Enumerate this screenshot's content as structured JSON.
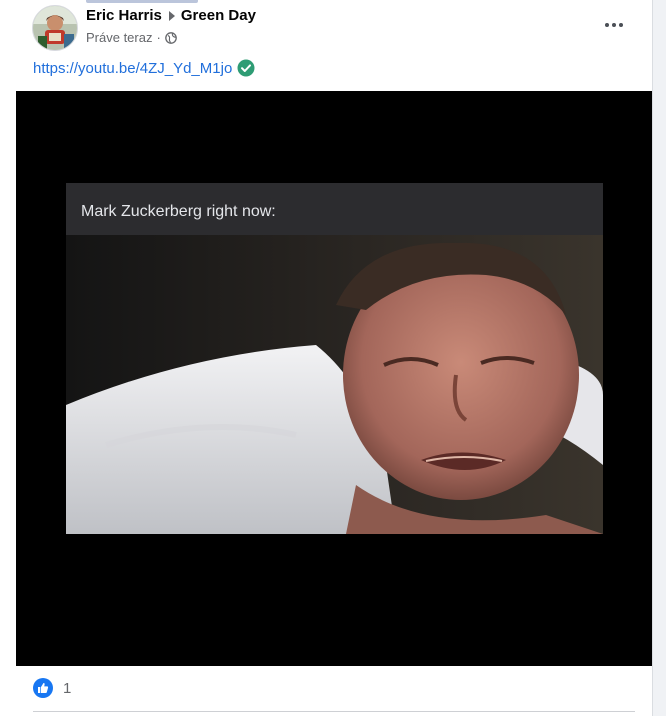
{
  "post": {
    "author": "Eric Harris",
    "group": "Green Day",
    "timestamp": "Práve teraz",
    "separator": "·",
    "privacy_icon": "globe-icon",
    "menu_icon": "more-options-icon",
    "link": "https://youtu.be/4ZJ_Yd_M1jo",
    "link_badge_icon": "verified-check-icon"
  },
  "media": {
    "caption": "Mark Zuckerberg right now:"
  },
  "reactions": {
    "icon": "like-icon",
    "count": "1"
  },
  "colors": {
    "link": "#216fdb",
    "verified": "#2e9c74",
    "like": "#1877f2",
    "media_background": "#000000"
  }
}
